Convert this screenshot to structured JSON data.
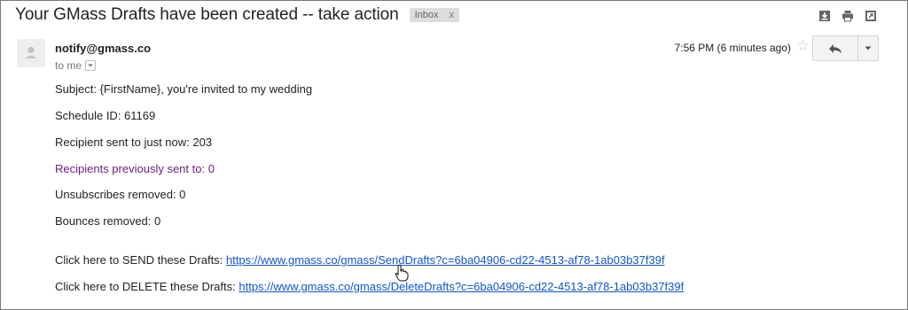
{
  "email": {
    "subject": "Your GMass Drafts have been created -- take action",
    "label": "Inbox",
    "label_remove": "x",
    "sender": "notify@gmass.co",
    "recipient_label": "to me",
    "time": "7:56 PM (6 minutes ago)",
    "body": {
      "subject_line": "Subject: {FirstName}, you're invited to my wedding",
      "schedule_id": "Schedule ID: 61169",
      "recipient_sent": "Recipient sent to just now: 203",
      "recipients_previous": "Recipients previously sent to: 0",
      "unsubscribes": "Unsubscribes removed: 0",
      "bounces": "Bounces removed: 0",
      "send_prefix": "Click here to SEND these Drafts: ",
      "send_link": "https://www.gmass.co/gmass/SendDrafts?c=6ba04906-cd22-4513-af78-1ab03b37f39f",
      "delete_prefix": "Click here to DELETE these Drafts: ",
      "delete_link": "https://www.gmass.co/gmass/DeleteDrafts?c=6ba04906-cd22-4513-af78-1ab03b37f39f"
    }
  },
  "icons": {
    "top_toolbar": [
      "download-icon",
      "print-icon",
      "new-window-icon"
    ],
    "avatar": "person-icon",
    "star": "star-icon",
    "reply": "reply-icon",
    "more": "chevron-down-icon",
    "cursor": "hand-cursor-icon"
  },
  "colors": {
    "link": "#1155cc",
    "visited_text": "#6b1e7f",
    "label_bg": "#dddddd"
  }
}
